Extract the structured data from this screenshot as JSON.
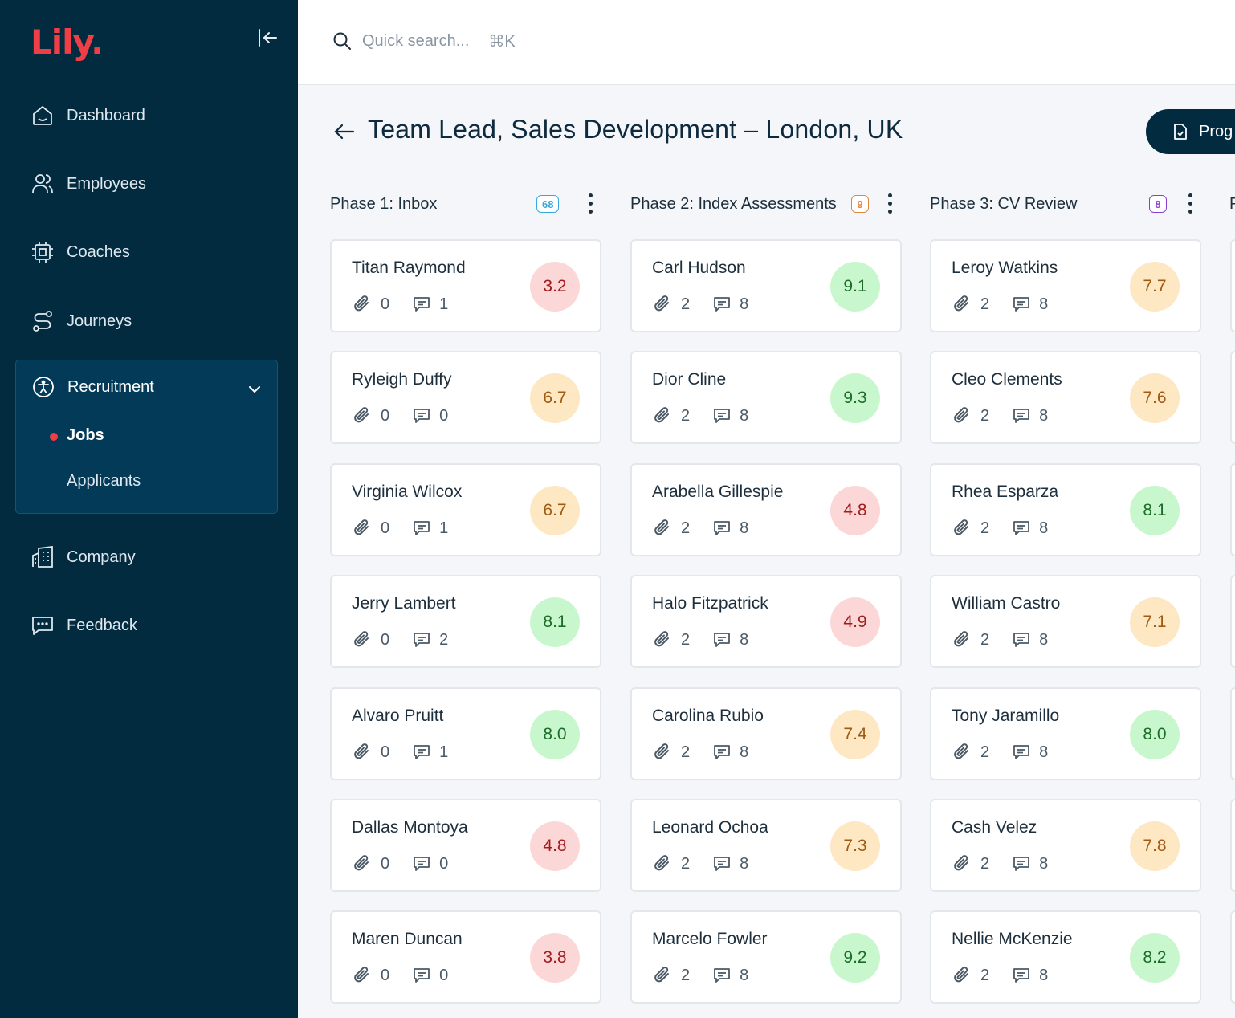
{
  "app": {
    "logo": "Lily."
  },
  "sidebar": {
    "items": [
      {
        "label": "Dashboard",
        "icon": "home-icon"
      },
      {
        "label": "Employees",
        "icon": "users-icon"
      },
      {
        "label": "Coaches",
        "icon": "chip-icon"
      },
      {
        "label": "Journeys",
        "icon": "route-icon"
      }
    ],
    "recruitment": {
      "label": "Recruitment",
      "icon": "accessibility-icon",
      "sub": [
        {
          "label": "Jobs",
          "active": true
        },
        {
          "label": "Applicants",
          "active": false
        }
      ]
    },
    "bottom_items": [
      {
        "label": "Company",
        "icon": "building-icon"
      },
      {
        "label": "Feedback",
        "icon": "message-icon"
      }
    ]
  },
  "search": {
    "placeholder": "Quick search...",
    "shortcut": "⌘K"
  },
  "page": {
    "title": "Team Lead, Sales Development – London, UK",
    "button_label": "Prog"
  },
  "phases": [
    {
      "title": "Phase 1: Inbox",
      "count": "68",
      "count_color": "#38a8dc",
      "cards": [
        {
          "name": "Titan Raymond",
          "attachments": "0",
          "comments": "1",
          "score": "3.2",
          "level": "red"
        },
        {
          "name": "Ryleigh Duffy",
          "attachments": "0",
          "comments": "0",
          "score": "6.7",
          "level": "orange"
        },
        {
          "name": "Virginia Wilcox",
          "attachments": "0",
          "comments": "1",
          "score": "6.7",
          "level": "orange"
        },
        {
          "name": "Jerry Lambert",
          "attachments": "0",
          "comments": "2",
          "score": "8.1",
          "level": "green"
        },
        {
          "name": "Alvaro Pruitt",
          "attachments": "0",
          "comments": "1",
          "score": "8.0",
          "level": "green"
        },
        {
          "name": "Dallas Montoya",
          "attachments": "0",
          "comments": "0",
          "score": "4.8",
          "level": "red"
        },
        {
          "name": "Maren Duncan",
          "attachments": "0",
          "comments": "0",
          "score": "3.8",
          "level": "red"
        }
      ]
    },
    {
      "title": "Phase 2: Index Assessments",
      "count": "9",
      "count_color": "#e0873a",
      "cards": [
        {
          "name": "Carl Hudson",
          "attachments": "2",
          "comments": "8",
          "score": "9.1",
          "level": "green"
        },
        {
          "name": "Dior Cline",
          "attachments": "2",
          "comments": "8",
          "score": "9.3",
          "level": "green"
        },
        {
          "name": "Arabella Gillespie",
          "attachments": "2",
          "comments": "8",
          "score": "4.8",
          "level": "red"
        },
        {
          "name": "Halo Fitzpatrick",
          "attachments": "2",
          "comments": "8",
          "score": "4.9",
          "level": "red"
        },
        {
          "name": "Carolina Rubio",
          "attachments": "2",
          "comments": "8",
          "score": "7.4",
          "level": "orange"
        },
        {
          "name": "Leonard Ochoa",
          "attachments": "2",
          "comments": "8",
          "score": "7.3",
          "level": "orange"
        },
        {
          "name": "Marcelo Fowler",
          "attachments": "2",
          "comments": "8",
          "score": "9.2",
          "level": "green"
        }
      ]
    },
    {
      "title": "Phase 3: CV Review",
      "count": "8",
      "count_color": "#8a3fd1",
      "cards": [
        {
          "name": "Leroy Watkins",
          "attachments": "2",
          "comments": "8",
          "score": "7.7",
          "level": "orange"
        },
        {
          "name": "Cleo Clements",
          "attachments": "2",
          "comments": "8",
          "score": "7.6",
          "level": "orange"
        },
        {
          "name": "Rhea Esparza",
          "attachments": "2",
          "comments": "8",
          "score": "8.1",
          "level": "green"
        },
        {
          "name": "William Castro",
          "attachments": "2",
          "comments": "8",
          "score": "7.1",
          "level": "orange"
        },
        {
          "name": "Tony Jaramillo",
          "attachments": "2",
          "comments": "8",
          "score": "8.0",
          "level": "green"
        },
        {
          "name": "Cash Velez",
          "attachments": "2",
          "comments": "8",
          "score": "7.8",
          "level": "orange"
        },
        {
          "name": "Nellie McKenzie",
          "attachments": "2",
          "comments": "8",
          "score": "8.2",
          "level": "green"
        }
      ]
    }
  ],
  "next_phase_initial": "P"
}
